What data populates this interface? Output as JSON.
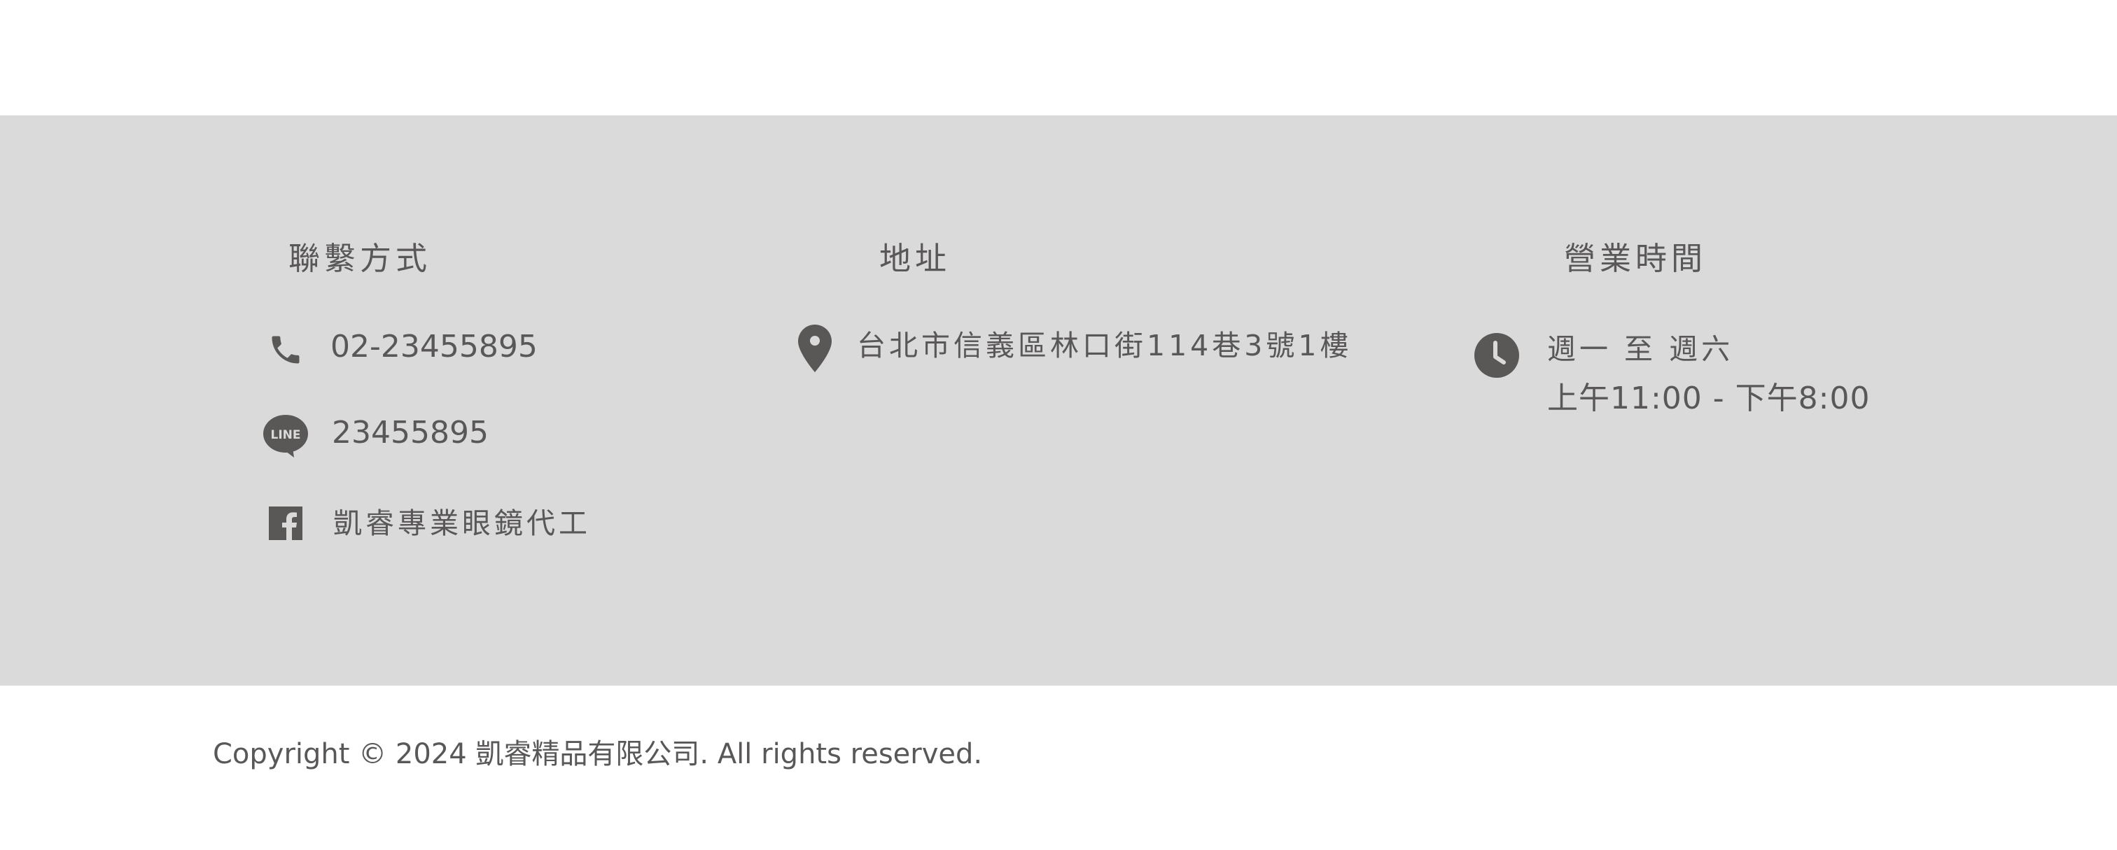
{
  "contact": {
    "heading": "聯繫方式",
    "phone": "02-23455895",
    "line_id": "23455895",
    "line_badge": "LINE",
    "facebook": "凱睿專業眼鏡代工",
    "icons": {
      "phone": "phone-icon",
      "line": "line-icon",
      "facebook": "facebook-icon"
    }
  },
  "address": {
    "heading": "地址",
    "text": "台北市信義區林口街114巷3號1樓",
    "icon": "location-pin-icon"
  },
  "hours": {
    "heading": "營業時間",
    "days": "週一 至 週六",
    "time": "上午11:00 - 下午8:00",
    "icon": "clock-icon"
  },
  "footer": {
    "copyright": "Copyright © 2024 凱睿精品有限公司. All rights reserved."
  },
  "colors": {
    "band": "#dadada",
    "text": "#595757",
    "icon": "#5a5757",
    "background": "#ffffff"
  }
}
